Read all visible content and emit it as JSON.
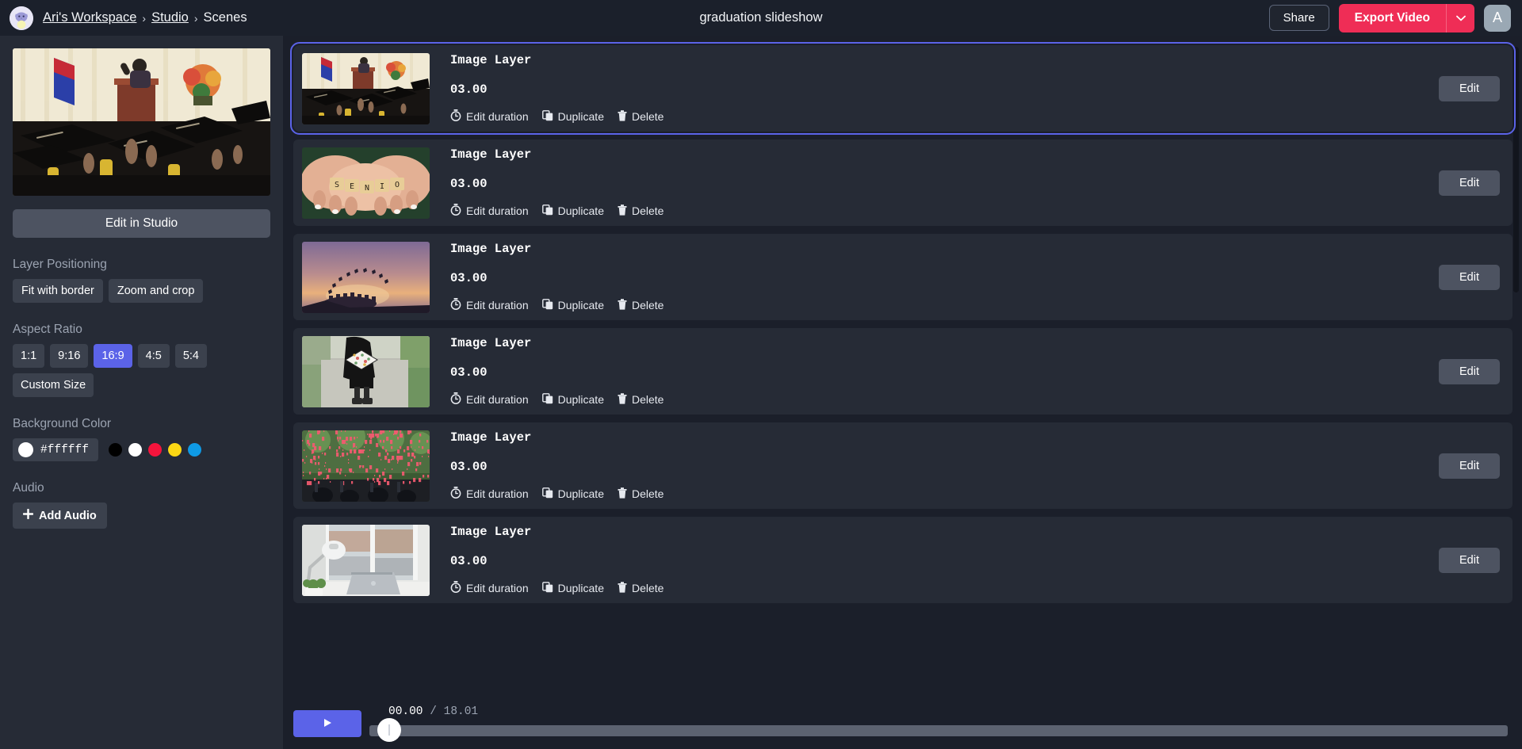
{
  "header": {
    "workspace_icon": "cat-avatar-icon",
    "breadcrumb": [
      "Ari's Workspace",
      "Studio",
      "Scenes"
    ],
    "breadcrumb_separator": "›",
    "document_title": "graduation slideshow",
    "share_label": "Share",
    "export_label": "Export Video",
    "export_caret_icon": "chevron-down-icon",
    "user_initial": "A",
    "accent_export": "#ef2d56",
    "accent_primary": "#5b63e8"
  },
  "sidebar": {
    "preview_alt": "graduation ceremony preview",
    "edit_in_studio_label": "Edit in Studio",
    "layer_positioning": {
      "label": "Layer Positioning",
      "options": [
        "Fit with border",
        "Zoom and crop"
      ],
      "selected": null
    },
    "aspect_ratio": {
      "label": "Aspect Ratio",
      "options": [
        "1:1",
        "9:16",
        "16:9",
        "4:5",
        "5:4",
        "Custom Size"
      ],
      "selected": "16:9"
    },
    "background_color": {
      "label": "Background Color",
      "value": "#ffffff",
      "swatches": [
        "#000000",
        "#ffffff",
        "#f5143c",
        "#fbd714",
        "#0f9ae5"
      ]
    },
    "audio": {
      "label": "Audio",
      "add_label": "Add Audio",
      "add_icon": "plus-icon"
    }
  },
  "main": {
    "actions": {
      "edit_duration": "Edit duration",
      "edit_duration_icon": "stopwatch-icon",
      "duplicate": "Duplicate",
      "duplicate_icon": "copy-icon",
      "delete": "Delete",
      "delete_icon": "trash-icon",
      "edit_button": "Edit"
    },
    "scenes": [
      {
        "name": "Image Layer",
        "duration": "03.00",
        "selected": true,
        "thumb": "graduation-ceremony-caps"
      },
      {
        "name": "Image Layer",
        "duration": "03.00",
        "selected": false,
        "thumb": "hands-senior-tiles"
      },
      {
        "name": "Image Layer",
        "duration": "03.00",
        "selected": false,
        "thumb": "sunset-caps-toss"
      },
      {
        "name": "Image Layer",
        "duration": "03.00",
        "selected": false,
        "thumb": "grad-cap-walking"
      },
      {
        "name": "Image Layer",
        "duration": "03.00",
        "selected": false,
        "thumb": "confetti-crowd"
      },
      {
        "name": "Image Layer",
        "duration": "03.00",
        "selected": false,
        "thumb": "desk-laptop-window"
      }
    ]
  },
  "player": {
    "play_icon": "play-icon",
    "current_time": "00.00",
    "separator": "/",
    "total_time": "18.01"
  },
  "cursor": {
    "glyph": "👆",
    "name": "pointing-hand-cursor"
  }
}
